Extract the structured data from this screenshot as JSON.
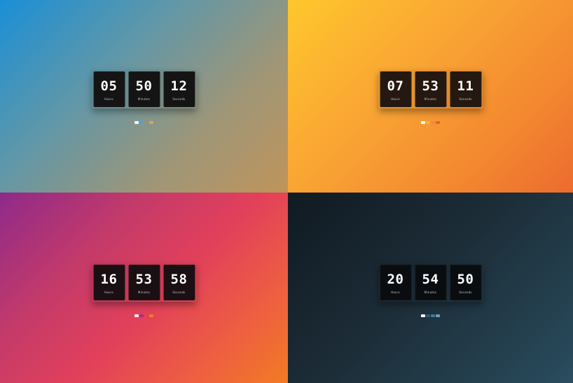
{
  "panels": [
    {
      "id": "blue-sand",
      "gradient": "linear-gradient(135deg,#1a8fd6 0%,#5e97aa 35%,#9f9677 70%,#c0945a 100%)",
      "box_color": "#141414",
      "clock": {
        "hours": "05",
        "minutes": "50",
        "seconds": "12",
        "hours_label": "Hours",
        "minutes_label": "Minutes",
        "seconds_label": "Seconds"
      },
      "footer_text": "",
      "footer_swatches": [
        "#ffffff",
        "#4aa3df",
        "#9d8f6a",
        "#e2a24a"
      ]
    },
    {
      "id": "yellow-orange",
      "gradient": "linear-gradient(135deg,#ffc72c 0%,#f9a534 40%,#f3862f 75%,#ec6b2f 100%)",
      "box_color": "#241810",
      "clock": {
        "hours": "07",
        "minutes": "53",
        "seconds": "11",
        "hours_label": "Hours",
        "minutes_label": "Minutes",
        "seconds_label": "Seconds"
      },
      "footer_text": "",
      "footer_swatches": [
        "#ffffff",
        "#f7b733",
        "#f4873a",
        "#ef5a3a"
      ]
    },
    {
      "id": "purple-pink-orange",
      "gradient": "linear-gradient(135deg,#8e2a8a 0%,#c33a6a 30%,#e2405a 55%,#ee6040 80%,#f27b23 100%)",
      "box_color": "#1a0f12",
      "clock": {
        "hours": "16",
        "minutes": "53",
        "seconds": "58",
        "hours_label": "Hours",
        "minutes_label": "Minutes",
        "seconds_label": "Seconds"
      },
      "footer_text": "",
      "footer_swatches": [
        "#ffffff",
        "#b02c7a",
        "#e24255",
        "#f27b23"
      ]
    },
    {
      "id": "dark-slate",
      "gradient": "linear-gradient(135deg,#101a21 0%,#1c2c37 45%,#24404f 80%,#2a4d5f 100%)",
      "box_color": "#0a0d10",
      "clock": {
        "hours": "20",
        "minutes": "54",
        "seconds": "50",
        "hours_label": "Hours",
        "minutes_label": "Minutes",
        "seconds_label": "Seconds"
      },
      "footer_text": "",
      "footer_swatches": [
        "#ffffff",
        "#2f5b6e",
        "#3d7a92",
        "#6aa1b8"
      ]
    }
  ]
}
